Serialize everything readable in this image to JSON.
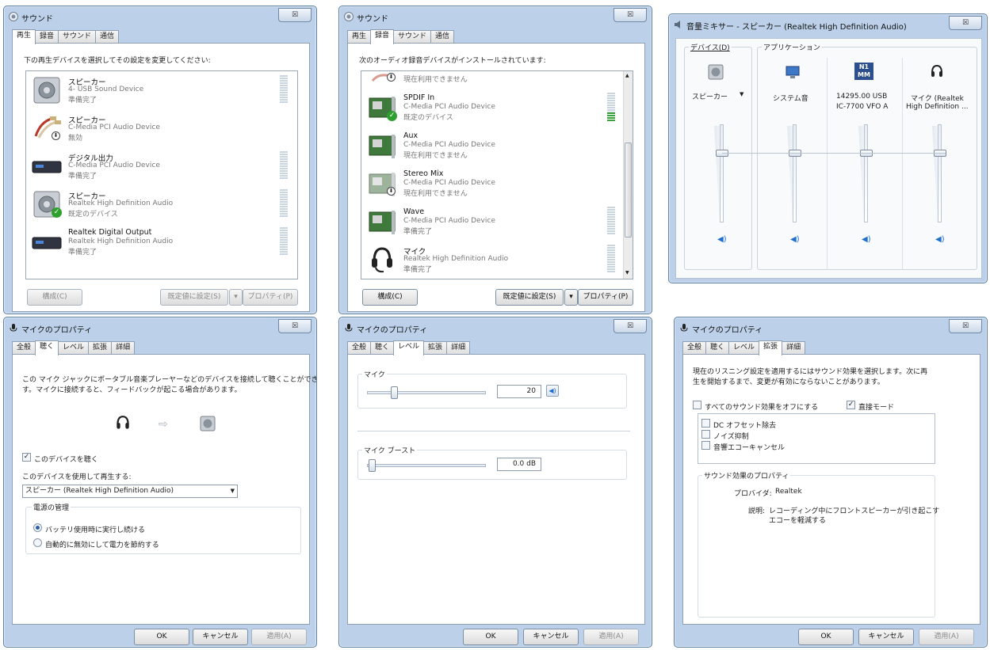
{
  "colors": {
    "accent": "#1e6fcf",
    "meter_active": "#3ea23e",
    "check": "#2fa02f",
    "frame": "#bcd1e9"
  },
  "icons": {
    "window": "speaker-icon",
    "close": "close-icon",
    "mic": "microphone-icon"
  },
  "win1": {
    "title": "サウンド",
    "close": "☒",
    "tabs": [
      "再生",
      "録音",
      "サウンド",
      "通信"
    ],
    "instruction": "下の再生デバイスを選択してその設定を変更してください:",
    "devices": [
      {
        "name": "スピーカー",
        "line1": "4- USB Sound Device",
        "line2": "準備完了"
      },
      {
        "name": "スピーカー",
        "line1": "C-Media PCI Audio Device",
        "line2": "無効"
      },
      {
        "name": "デジタル出力",
        "line1": "C-Media PCI Audio Device",
        "line2": "準備完了"
      },
      {
        "name": "スピーカー",
        "line1": "Realtek High Definition Audio",
        "line2": "既定のデバイス"
      },
      {
        "name": "Realtek Digital Output",
        "line1": "Realtek High Definition Audio",
        "line2": "準備完了"
      }
    ],
    "buttons": {
      "configure": "構成(C)",
      "set_default": "既定値に設定(S)",
      "properties": "プロパティ(P)"
    }
  },
  "win2": {
    "title": "サウンド",
    "close": "☒",
    "tabs": [
      "再生",
      "録音",
      "サウンド",
      "通信"
    ],
    "instruction": "次のオーディオ録音デバイスがインストールされています:",
    "partial_status": "現在利用できません",
    "devices": [
      {
        "name": "SPDIF In",
        "line1": "C-Media PCI Audio Device",
        "line2": "既定のデバイス",
        "level": 0.3
      },
      {
        "name": "Aux",
        "line1": "C-Media PCI Audio Device",
        "line2": "現在利用できません"
      },
      {
        "name": "Stereo Mix",
        "line1": "C-Media PCI Audio Device",
        "line2": "現在利用できません"
      },
      {
        "name": "Wave",
        "line1": "C-Media PCI Audio Device",
        "line2": "準備完了"
      },
      {
        "name": "マイク",
        "line1": "Realtek High Definition Audio",
        "line2": "準備完了"
      }
    ],
    "buttons": {
      "configure": "構成(C)",
      "set_default": "既定値に設定(S)",
      "properties": "プロパティ(P)"
    }
  },
  "win3": {
    "title": "音量ミキサー - スピーカー (Realtek High Definition Audio)",
    "close": "☒",
    "device_label": "デバイス(D)",
    "app_label": "アプリケーション",
    "device_name": "スピーカー",
    "apps": [
      {
        "name1": "システム音",
        "name2": "",
        "level": 0.55
      },
      {
        "name1": "14295.00 USB",
        "name2": "IC-7700 VFO A",
        "level": 0.55
      },
      {
        "name1": "マイク (Realtek",
        "name2": "High Definition ...",
        "level": 0.55
      }
    ],
    "device_level": 0.55,
    "app_icon_text": "N1\nMM"
  },
  "win4": {
    "title": "マイクのプロパティ",
    "close": "☒",
    "tabs": [
      "全般",
      "聴く",
      "レベル",
      "拡張",
      "詳細"
    ],
    "desc1": "この マイク ジャックにポータブル音楽プレーヤーなどのデバイスを接続して聴くことができま",
    "desc2": "す。マイクに接続すると、フィードバックが起こる場合があります。",
    "arrow": "⇨",
    "listen_label": "このデバイスを聴く",
    "playback_label": "このデバイスを使用して再生する:",
    "playback_value": "スピーカー (Realtek High Definition Audio)",
    "power_group": "電源の管理",
    "radio1": "バッテリ使用時に実行し続ける",
    "radio2": "自動的に無効にして電力を節約する",
    "buttons": {
      "ok": "OK",
      "cancel": "キャンセル",
      "apply": "適用(A)"
    }
  },
  "win5": {
    "title": "マイクのプロパティ",
    "close": "☒",
    "tabs": [
      "全般",
      "聴く",
      "レベル",
      "拡張",
      "詳細"
    ],
    "mic_group": "マイク",
    "mic_value": "20",
    "mic_level": 0.2,
    "boost_group": "マイク ブースト",
    "boost_value": "0.0 dB",
    "boost_level": 0.0,
    "buttons": {
      "ok": "OK",
      "cancel": "キャンセル",
      "apply": "適用(A)"
    }
  },
  "win6": {
    "title": "マイクのプロパティ",
    "close": "☒",
    "tabs": [
      "全般",
      "聴く",
      "レベル",
      "拡張",
      "詳細"
    ],
    "desc1": "現在のリスニング設定を適用するにはサウンド効果を選択します。次に再",
    "desc2": "生を開始するまで、変更が有効にならないことがあります。",
    "disable_all": "すべてのサウンド効果をオフにする",
    "direct_mode": "直接モード",
    "effects": [
      "DC オフセット除去",
      "ノイズ抑制",
      "音響エコーキャンセル"
    ],
    "props_group": "サウンド効果のプロパティ",
    "provider_label": "プロバイダ:",
    "provider_value": "Realtek",
    "desc_label": "説明:",
    "desc_value1": "レコーディング中にフロントスピーカーが引き起こす",
    "desc_value2": "エコーを軽減する",
    "buttons": {
      "ok": "OK",
      "cancel": "キャンセル",
      "apply": "適用(A)"
    }
  }
}
